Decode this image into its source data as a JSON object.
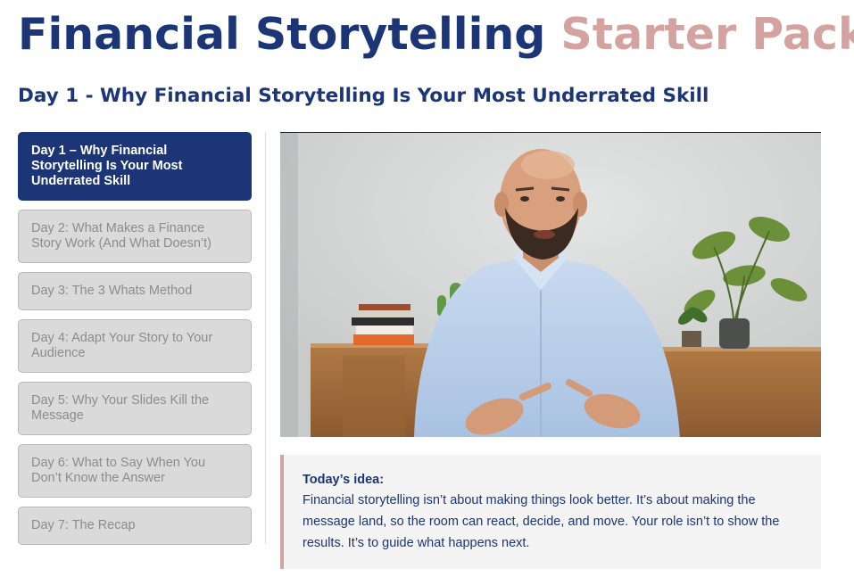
{
  "header": {
    "title_part1": "Financial Storytelling",
    "title_part2": "Starter Pack",
    "subtitle": "Day 1 - Why Financial Storytelling Is Your Most Underrated Skill"
  },
  "sidebar": {
    "items": [
      {
        "label": "Day 1 – Why Financial Storytelling Is Your Most Underrated Skill",
        "active": true
      },
      {
        "label": "Day 2: What Makes a Finance Story Work (And What Doesn’t)",
        "active": false
      },
      {
        "label": "Day 3: The 3 Whats Method",
        "active": false
      },
      {
        "label": "Day 4: Adapt Your Story to Your Audience",
        "active": false
      },
      {
        "label": "Day 5: Why Your Slides Kill the Message",
        "active": false
      },
      {
        "label": "Day 6: What to Say When You Don’t Know the Answer",
        "active": false
      },
      {
        "label": "Day 7: The Recap",
        "active": false
      }
    ]
  },
  "idea": {
    "label": "Today’s idea:",
    "text": "Financial storytelling isn’t about making things look better. It’s about making the message land, so the room can react, decide, and move. Your role isn’t to show the results. It’s to guide what happens next."
  },
  "colors": {
    "navy": "#1b3577",
    "rose": "#d4a29f",
    "inactive_bg": "#dadada",
    "inactive_text": "#8c8c8c",
    "idea_bg": "#f4f4f4"
  }
}
